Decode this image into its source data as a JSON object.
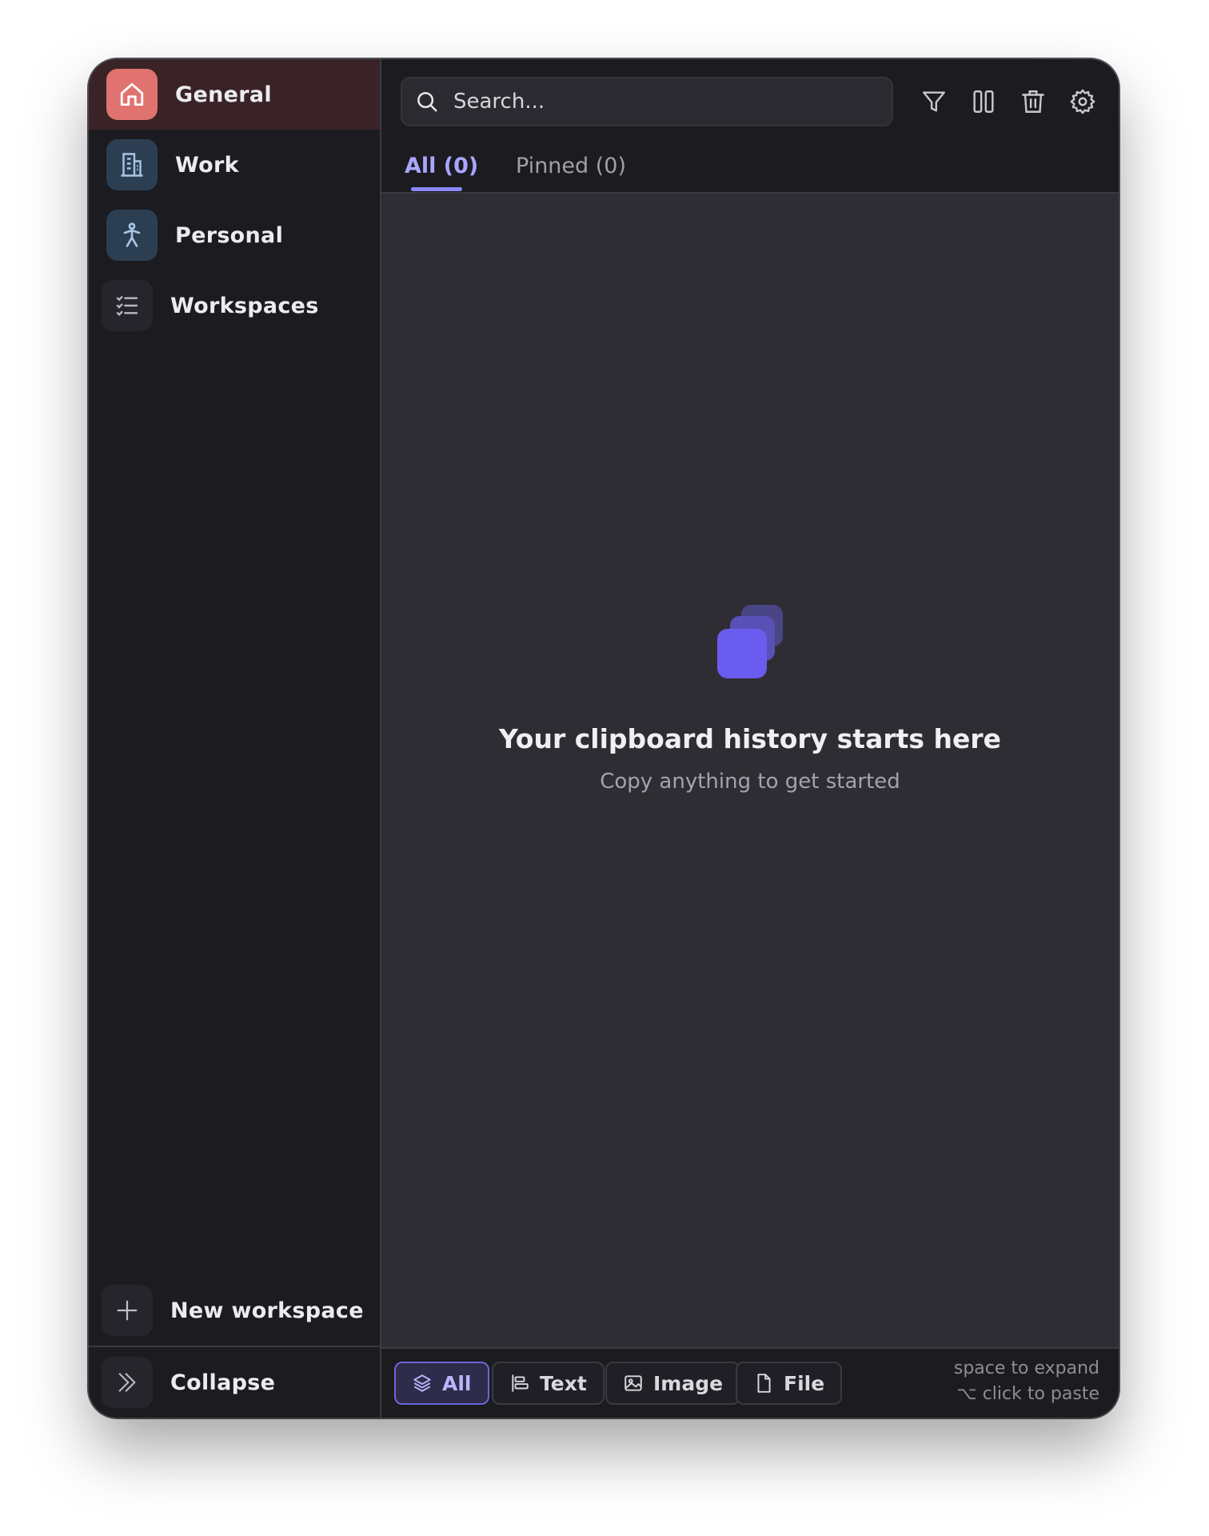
{
  "sidebar": {
    "items": [
      {
        "label": "General",
        "icon": "home-icon",
        "active": true
      },
      {
        "label": "Work",
        "icon": "building-icon"
      },
      {
        "label": "Personal",
        "icon": "person-icon"
      },
      {
        "label": "Workspaces",
        "icon": "checklist-icon"
      }
    ],
    "new_workspace": "New workspace",
    "collapse": "Collapse"
  },
  "search": {
    "placeholder": "Search..."
  },
  "toolbar": {
    "icons": [
      "filter-icon",
      "columns-icon",
      "trash-icon",
      "gear-icon"
    ]
  },
  "tabs": [
    {
      "label": "All (0)",
      "active": true
    },
    {
      "label": "Pinned (0)"
    }
  ],
  "empty_state": {
    "title": "Your clipboard history starts here",
    "subtitle": "Copy anything to get started"
  },
  "filters": [
    {
      "label": "All",
      "icon": "layers-icon",
      "active": true
    },
    {
      "label": "Text",
      "icon": "text-align-icon"
    },
    {
      "label": "Image",
      "icon": "image-icon"
    },
    {
      "label": "File",
      "icon": "file-icon"
    }
  ],
  "hints": {
    "expand": "space to expand",
    "paste": "⌥ click to paste"
  },
  "colors": {
    "accent": "#8b86ff",
    "general_workspace": "#e0736f",
    "empty_icon": "#6b5cf0"
  }
}
